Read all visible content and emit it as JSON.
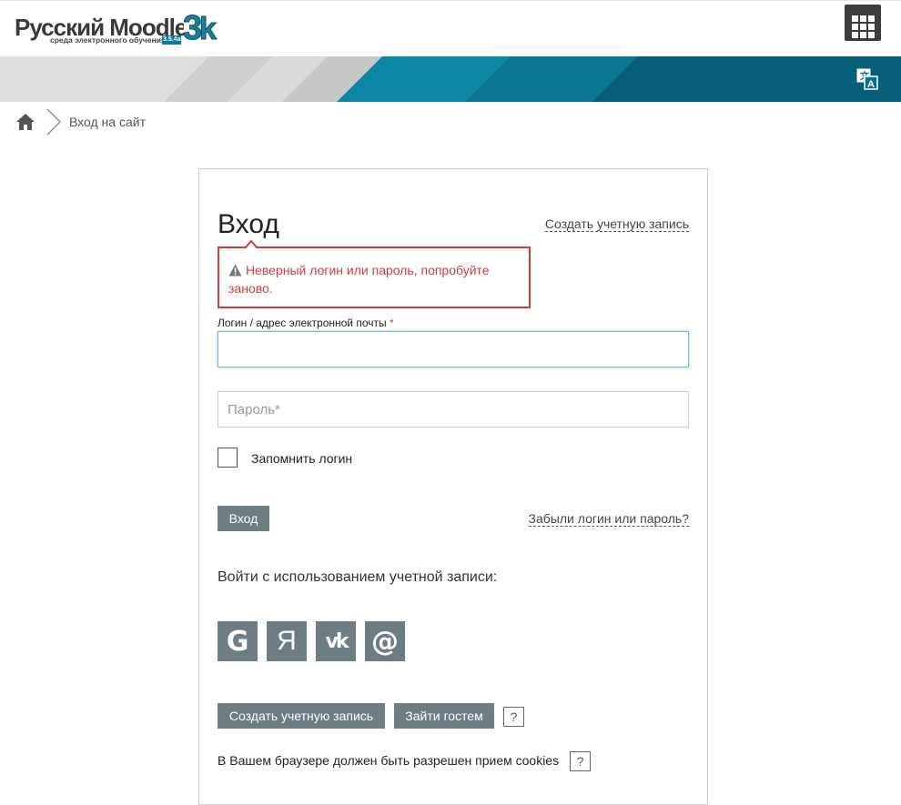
{
  "header": {
    "logo_name": "Русский Moodle",
    "logo_subtitle": "среда электронного обучения",
    "logo_version": "3.5.4a",
    "logo_mark": "3k",
    "apps_icon": "grid-icon"
  },
  "banner": {
    "language_icon": "translate-icon"
  },
  "breadcrumb": {
    "home_icon": "home-icon",
    "current": "Вход на сайт"
  },
  "login": {
    "title": "Вход",
    "create_account_link": "Создать учетную запись",
    "error_message": "Неверный логин или пароль, попробуйте заново.",
    "username_label": "Логин / адрес электронной почты",
    "required_marker": "*",
    "username_value": "",
    "password_placeholder": "Пароль*",
    "remember_label": "Запомнить логин",
    "remember_checked": false,
    "submit_label": "Вход",
    "forgot_link": "Забыли логин или пароль?"
  },
  "oauth": {
    "heading": "Войти с использованием учетной записи:",
    "providers": [
      {
        "label": "G",
        "icon": "google-icon"
      },
      {
        "label": "Я",
        "icon": "yandex-icon"
      },
      {
        "label": "vk",
        "icon": "vk-icon"
      },
      {
        "label": "@",
        "icon": "mail-icon"
      }
    ]
  },
  "footer_actions": {
    "create_account_button": "Создать учетную запись",
    "guest_button": "Зайти гостем",
    "help_symbol": "?",
    "cookie_notice": "В Вашем браузере должен быть разрешен прием cookies"
  },
  "colors": {
    "banner_teal": "#0a6f8c",
    "button_gray": "#6e7d82",
    "error_red": "#cf3c3c",
    "focus_blue": "#7fb1e3"
  }
}
